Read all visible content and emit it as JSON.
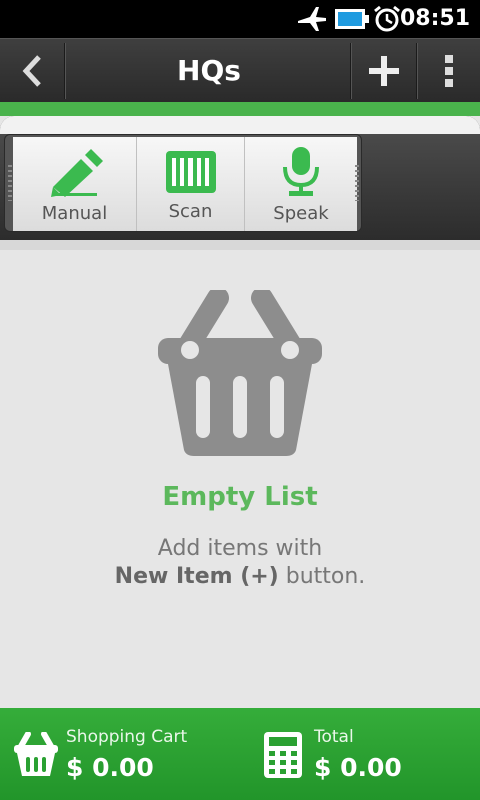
{
  "status_bar": {
    "time": "08:51",
    "icons": [
      "airplane-icon",
      "battery-icon",
      "alarm-icon"
    ]
  },
  "action_bar": {
    "title": "HQs",
    "icons": [
      "back-icon",
      "add-icon",
      "overflow-icon"
    ]
  },
  "add_popup": {
    "options": [
      {
        "label": "Manual",
        "icon": "pencil-icon"
      },
      {
        "label": "Scan",
        "icon": "barcode-icon"
      },
      {
        "label": "Speak",
        "icon": "microphone-icon"
      }
    ]
  },
  "empty_state": {
    "icon": "basket-icon",
    "title": "Empty List",
    "line1": "Add items with",
    "line2_bold": "New Item (+)",
    "line2_rest": " button."
  },
  "bottom_bar": {
    "cart_label": "Shopping Cart",
    "cart_value": "$ 0.00",
    "total_label": "Total",
    "total_value": "$ 0.00"
  },
  "colors": {
    "accent_green": "#4ab34c",
    "empty_title_green": "#5cb85c",
    "bottom_bar_green": "#2aa132"
  }
}
